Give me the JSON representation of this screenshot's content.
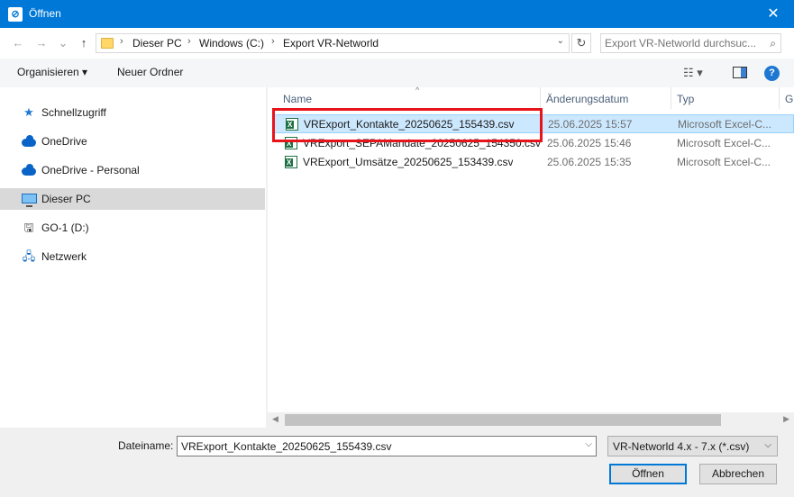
{
  "window": {
    "title": "Öffnen",
    "close_glyph": "✕"
  },
  "nav": {
    "back_glyph": "←",
    "forward_glyph": "→",
    "recent_glyph": "⌄",
    "up_glyph": "↑",
    "breadcrumbs": [
      "Dieser PC",
      "Windows (C:)",
      "Export VR-Networld"
    ],
    "separator": "›",
    "refresh_glyph": "↻",
    "search_placeholder": "Export VR-Networld durchsuc..."
  },
  "toolbar": {
    "organize_label": "Organisieren ▾",
    "new_folder_label": "Neuer Ordner",
    "view_glyph": "☷ ▾",
    "help_glyph": "?"
  },
  "sidebar": {
    "items": [
      {
        "label": "Schnellzugriff",
        "icon": "star-icon",
        "glyph": "★",
        "color": "#1e78d2"
      },
      {
        "label": "OneDrive",
        "icon": "cloud-icon"
      },
      {
        "label": "OneDrive - Personal",
        "icon": "cloud-icon"
      },
      {
        "label": "Dieser PC",
        "icon": "computer-icon",
        "active": true
      },
      {
        "label": "GO-1 (D:)",
        "icon": "usb-drive-icon",
        "glyph": "🖫"
      },
      {
        "label": "Netzwerk",
        "icon": "network-icon",
        "glyph": "🖧"
      }
    ]
  },
  "list": {
    "columns": [
      "Name",
      "Änderungsdatum",
      "Typ",
      "G"
    ],
    "sort_glyph": "^",
    "files": [
      {
        "name": "VRExport_Kontakte_20250625_155439.csv",
        "date": "25.06.2025 15:57",
        "type": "Microsoft Excel-C...",
        "selected": true
      },
      {
        "name": "VRExport_SEPAMandate_20250625_154350.csv",
        "date": "25.06.2025 15:46",
        "type": "Microsoft Excel-C..."
      },
      {
        "name": "VRExport_Umsätze_20250625_153439.csv",
        "date": "25.06.2025 15:35",
        "type": "Microsoft Excel-C..."
      }
    ],
    "file_icon_letter": "X"
  },
  "scrollbar": {
    "left_glyph": "◀",
    "right_glyph": "▶"
  },
  "footer": {
    "filename_label": "Dateiname:",
    "filename_value": "VRExport_Kontakte_20250625_155439.csv",
    "dropdown_glyph": "⌵",
    "filter_value": "VR-Networld 4.x - 7.x (*.csv)",
    "open_label": "Öffnen",
    "cancel_label": "Abbrechen"
  },
  "colors": {
    "titlebar": "#0078d7",
    "selection": "#cce8ff",
    "highlight": "#e8141b"
  }
}
